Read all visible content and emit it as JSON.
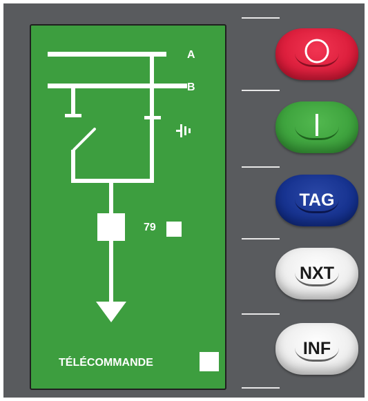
{
  "display": {
    "busbar_a_label": "A",
    "busbar_b_label": "B",
    "autoreclose_label": "79",
    "remote_control_label": "TÉLÉCOMMANDE"
  },
  "buttons": {
    "open": {
      "symbol": "O",
      "icon": "open-circle-icon",
      "color": "#d81a38"
    },
    "close": {
      "symbol": "I",
      "icon": "close-bar-icon",
      "color": "#3a9f3a"
    },
    "tag": {
      "label": "TAG",
      "color": "#132f8c"
    },
    "next": {
      "label": "NXT",
      "color": "#ececec"
    },
    "info": {
      "label": "INF",
      "color": "#ececec"
    }
  },
  "colors": {
    "lcd_background": "#3d9e3f",
    "panel_background": "#595b5e"
  }
}
